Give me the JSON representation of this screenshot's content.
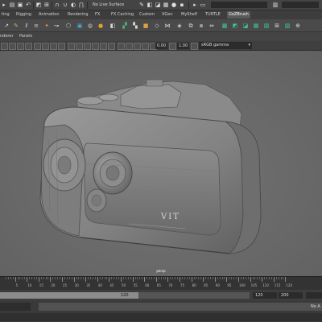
{
  "status_line": {
    "live_surface": "No Live Surface",
    "icons": [
      "folder-icon",
      "save-icon",
      "undo-icon",
      "redo-icon",
      "select-mode-icon",
      "snap-grid-icon",
      "snap-curve-icon",
      "snap-point-icon",
      "magnet-icon",
      "render-icon",
      "ipr-render-icon",
      "render-settings-icon",
      "hypershade-icon",
      "camera-icon",
      "playblast-icon",
      "toggle-panel-icon"
    ]
  },
  "shelf": {
    "tabs": [
      "ting",
      "Rigging",
      "Animation",
      "Rendering",
      "FX",
      "FX Caching",
      "Custom",
      "XGen",
      "MyShelf",
      "TURTLE",
      "GoZBrush"
    ],
    "active_tab": "GoZBrush",
    "icon_colors": [
      "#d8d8d8",
      "#8fcf5f",
      "#d8d8d8",
      "#c8c8c8",
      "#e08a3a",
      "#d8d8d8",
      "#d8d8d8",
      "#4fa3d8",
      "#c4c4c4",
      "#e0a030",
      "#d8d8d8",
      "#4fb07a",
      "#d8d8d8",
      "#e0e0e0",
      "#d8d8d8",
      "#d8d8d8",
      "#45c49a",
      "#45c49a",
      "#45c49a",
      "#45c49a",
      "#45c49a",
      "#d8d8d8",
      "#45c49a",
      "#d8d8d8"
    ]
  },
  "panel_menu": {
    "items": [
      "nderer",
      "Panels"
    ]
  },
  "panel_toolbar": {
    "near_clip": "0.00",
    "gamma": "1.00",
    "color_space": "sRGB gamma"
  },
  "viewport": {
    "camera": "persp",
    "model": "camera-3d-model",
    "text_on_model": "VIT"
  },
  "timeline": {
    "ticks": [
      "5",
      "10",
      "15",
      "20",
      "25",
      "30",
      "35",
      "40",
      "45",
      "50",
      "55",
      "60",
      "65",
      "70",
      "75",
      "80",
      "85",
      "90",
      "95",
      "100",
      "105",
      "110",
      "115",
      "120"
    ]
  },
  "range_slider": {
    "range_end": "120",
    "anim_end": "120",
    "playback_end": "200",
    "frame_rate": "No A"
  }
}
